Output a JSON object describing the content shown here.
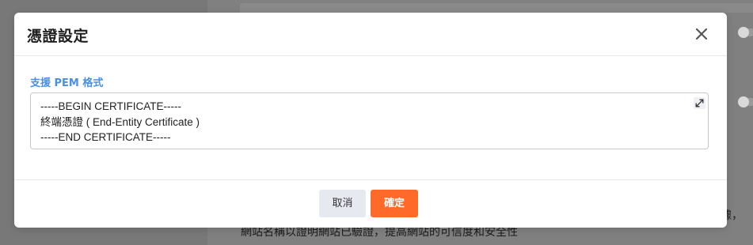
{
  "background": {
    "partial_text_right": "據，",
    "partial_text_bottom": "網站名稱以證明網站已驗證，提高網站的可信度和安全性"
  },
  "modal": {
    "title": "憑證設定",
    "field_label": "支援 PEM 格式",
    "certificate_lines": [
      "-----BEGIN CERTIFICATE-----",
      "終端憑證 ( End-Entity Certificate )",
      "-----END CERTIFICATE-----"
    ],
    "cancel_label": "取消",
    "confirm_label": "確定"
  },
  "colors": {
    "accent_label": "#4a90e2",
    "confirm_button": "#ff6a2a",
    "cancel_button": "#e6e9f0",
    "overlay": "#808081"
  },
  "icons": {
    "close": "close-icon",
    "expand": "expand-icon"
  }
}
